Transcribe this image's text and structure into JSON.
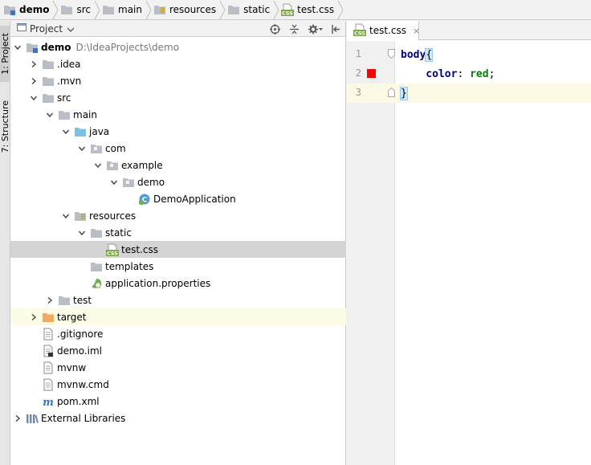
{
  "breadcrumb": {
    "items": [
      {
        "label": "demo",
        "icon": "module-folder-icon",
        "bold": true
      },
      {
        "label": "src",
        "icon": "folder-icon"
      },
      {
        "label": "main",
        "icon": "folder-icon"
      },
      {
        "label": "resources",
        "icon": "resources-folder-icon"
      },
      {
        "label": "static",
        "icon": "folder-icon"
      },
      {
        "label": "test.css",
        "icon": "css-file-icon"
      }
    ]
  },
  "side_strip": {
    "project_num": "1",
    "project_label": ": Project",
    "structure_num": "7",
    "structure_label": ": Structure"
  },
  "project_panel": {
    "title": "Project",
    "tools": [
      "target-icon",
      "collapse-all-icon",
      "gear-icon",
      "hide-icon"
    ]
  },
  "tree": [
    {
      "name": "demo",
      "path": "D:\\IdeaProjects\\demo",
      "bold": true,
      "level": 0,
      "expanded": true,
      "icon": "module-folder-icon"
    },
    {
      "name": ".idea",
      "level": 1,
      "expanded": false,
      "icon": "folder-icon"
    },
    {
      "name": ".mvn",
      "level": 1,
      "expanded": false,
      "icon": "folder-icon"
    },
    {
      "name": "src",
      "level": 1,
      "expanded": true,
      "icon": "folder-icon"
    },
    {
      "name": "main",
      "level": 2,
      "expanded": true,
      "icon": "folder-icon"
    },
    {
      "name": "java",
      "level": 3,
      "expanded": true,
      "icon": "source-folder-icon"
    },
    {
      "name": "com",
      "level": 4,
      "expanded": true,
      "icon": "package-icon"
    },
    {
      "name": "example",
      "level": 5,
      "expanded": true,
      "icon": "package-icon"
    },
    {
      "name": "demo",
      "level": 6,
      "expanded": true,
      "icon": "package-icon"
    },
    {
      "name": "DemoApplication",
      "level": 7,
      "icon": "spring-class-icon"
    },
    {
      "name": "resources",
      "level": 3,
      "expanded": true,
      "icon": "resources-folder-icon"
    },
    {
      "name": "static",
      "level": 4,
      "expanded": true,
      "icon": "folder-icon"
    },
    {
      "name": "test.css",
      "level": 5,
      "icon": "css-file-icon",
      "selected": true
    },
    {
      "name": "templates",
      "level": 4,
      "icon": "folder-icon"
    },
    {
      "name": "application.properties",
      "level": 4,
      "icon": "spring-properties-icon"
    },
    {
      "name": "test",
      "level": 2,
      "expanded": false,
      "icon": "folder-icon"
    },
    {
      "name": "target",
      "level": 1,
      "expanded": false,
      "icon": "excluded-folder-icon",
      "highlight": true
    },
    {
      "name": ".gitignore",
      "level": 1,
      "icon": "text-file-icon"
    },
    {
      "name": "demo.iml",
      "level": 1,
      "icon": "iml-file-icon"
    },
    {
      "name": "mvnw",
      "level": 1,
      "icon": "text-file-icon"
    },
    {
      "name": "mvnw.cmd",
      "level": 1,
      "icon": "text-file-icon"
    },
    {
      "name": "pom.xml",
      "level": 1,
      "icon": "maven-icon"
    },
    {
      "name": "External Libraries",
      "level": 0,
      "expanded": false,
      "icon": "libraries-icon"
    }
  ],
  "editor": {
    "tab_label": "test.css",
    "tab_close": "×",
    "line_numbers": [
      "1",
      "2",
      "3"
    ],
    "lines": [
      [
        {
          "t": "body",
          "c": "#000080",
          "b": true
        },
        {
          "t": "{",
          "c": "#000000"
        }
      ],
      [
        {
          "t": "    color",
          "c": "#000080",
          "b": true
        },
        {
          "t": ": ",
          "c": "#000000"
        },
        {
          "t": "red",
          "c": "#007f00",
          "b": true
        },
        {
          "t": ";",
          "c": "#000000"
        }
      ],
      [
        {
          "t": "}",
          "c": "#000000"
        }
      ]
    ],
    "color_swatch": "#ff0000",
    "current_line": 3
  },
  "colors": {
    "folder": "#b9bec6",
    "source_folder": "#7cc1e4",
    "excluded_folder": "#f3a964",
    "spring_green": "#6cb052",
    "selection": "#d4d4d4",
    "current_line": "#fcfae5"
  }
}
